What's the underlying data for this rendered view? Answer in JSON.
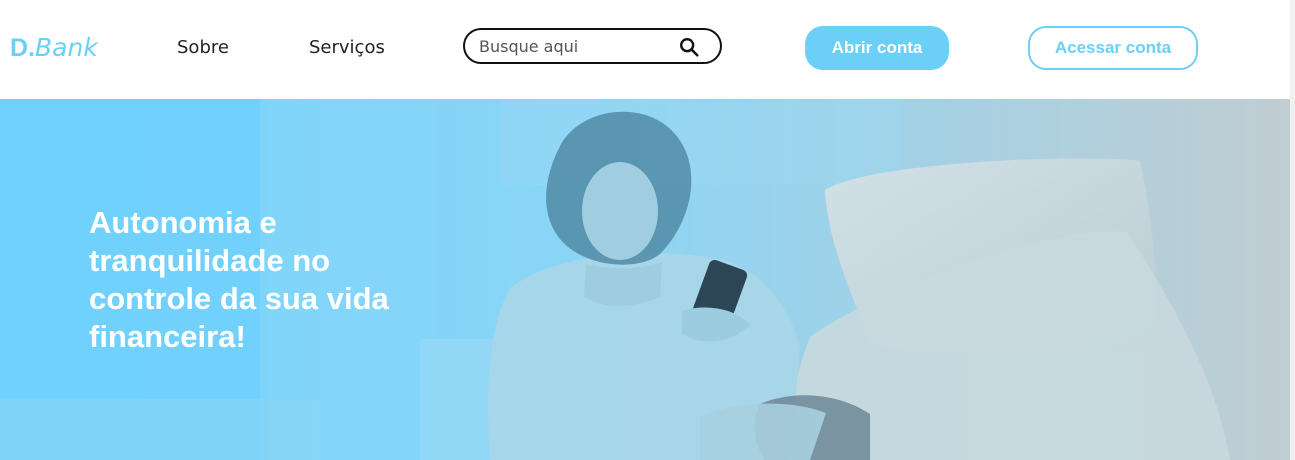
{
  "brand": {
    "strong": "D.",
    "light": "Bank"
  },
  "nav": {
    "items": [
      {
        "label": "Sobre"
      },
      {
        "label": "Serviços"
      }
    ]
  },
  "search": {
    "placeholder": "Busque aqui",
    "icon": "search-icon"
  },
  "actions": {
    "open_account": "Abrir conta",
    "access_account": "Acessar conta"
  },
  "hero": {
    "title": "Autonomia e tranquilidade no controle da sua vida financeira!"
  },
  "colors": {
    "accent": "#6ccff6",
    "text_dark": "#222222",
    "hero_text": "#ffffff"
  }
}
